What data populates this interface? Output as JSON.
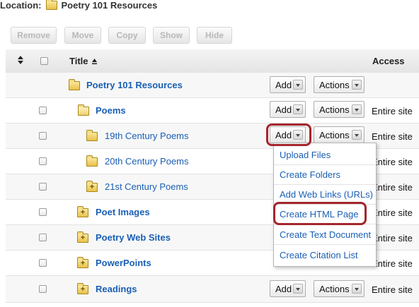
{
  "location": {
    "label": "Location:",
    "path": "Poetry 101 Resources"
  },
  "toolbar": {
    "remove": "Remove",
    "move": "Move",
    "copy": "Copy",
    "show": "Show",
    "hide": "Hide"
  },
  "table": {
    "header": {
      "title": "Title",
      "access": "Access"
    },
    "rows": [
      {
        "name": "Poetry 101 Resources",
        "access": "",
        "has_add": true,
        "has_actions": true
      },
      {
        "name": "Poems",
        "access": "Entire site",
        "has_add": true,
        "has_actions": true
      },
      {
        "name": "19th Century Poems",
        "access": "Entire site",
        "has_add": true,
        "has_actions": true
      },
      {
        "name": "20th Century Poems",
        "access": "Entire site",
        "has_add": false,
        "has_actions": false
      },
      {
        "name": "21st Century Poems",
        "access": "Entire site",
        "has_add": false,
        "has_actions": false
      },
      {
        "name": "Poet Images",
        "access": "Entire site",
        "has_add": false,
        "has_actions": false
      },
      {
        "name": "Poetry Web Sites",
        "access": "Entire site",
        "has_add": false,
        "has_actions": false
      },
      {
        "name": "PowerPoints",
        "access": "Entire site",
        "has_add": false,
        "has_actions": false
      },
      {
        "name": "Readings",
        "access": "Entire site",
        "has_add": true,
        "has_actions": true
      }
    ],
    "add_label": "Add",
    "actions_label": "Actions"
  },
  "add_menu": {
    "items": [
      "Upload Files",
      "Create Folders",
      "Add Web Links (URLs)",
      "Create HTML Page",
      "Create Text Document",
      "Create Citation List"
    ],
    "highlighted": "Create HTML Page"
  },
  "colors": {
    "link": "#1a5fb4",
    "highlight": "#a3262d",
    "folder": "#e9c14a"
  },
  "icons": [
    "folder-icon",
    "folder-open-icon",
    "folder-plus-icon",
    "sort-icon",
    "sort-ascending-icon",
    "dropdown-arrow-icon",
    "checkbox"
  ]
}
